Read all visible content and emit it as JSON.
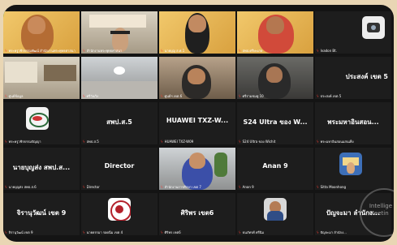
{
  "tiles": [
    {
      "caption": "พระครูวชิรธรรมพัฒน์ สำนักงานพระพุทธศาสนา",
      "name": ""
    },
    {
      "caption": "สำนักงานพระพุทธศาสนา",
      "name": ""
    },
    {
      "caption": "นายบุญ ส.ศ.1",
      "name": ""
    },
    {
      "caption": "สพป.ศรีษะเกษ",
      "name": ""
    },
    {
      "caption": "Ivadon Bt.",
      "name": ""
    },
    {
      "caption": "ศูนย์ข้อมูล",
      "name": ""
    },
    {
      "caption": "ศรีวังเวิง",
      "name": ""
    },
    {
      "caption": "ศูนย์ฯ เขต 6",
      "name": ""
    },
    {
      "caption": "ศรีรามชมพู 10",
      "name": ""
    },
    {
      "caption": "ประสงค์ เขต 5",
      "name": "ประสงค์ เขต 5"
    },
    {
      "caption": "พระครูวชิรธรรมปัญญา",
      "name": ""
    },
    {
      "caption": "สพป.ส.5",
      "name": "สพป.ส.5"
    },
    {
      "caption": "HUAWEI TXZ-W09",
      "name": "HUAWEI TXZ-W..."
    },
    {
      "caption": "S24 Ultra ของ Wichit",
      "name": "S24 Ultra ของ W..."
    },
    {
      "caption": "พระมหาอินสอนแสนเพ็ง",
      "name": "พระมหาอินสอน..."
    },
    {
      "caption": "นายบุญส่ง สพป.ส.6",
      "name": "นายบุญส่ง สพป.ส..."
    },
    {
      "caption": "Director",
      "name": "Director"
    },
    {
      "caption": "สำนักงานการศึกษา เขต 7",
      "name": ""
    },
    {
      "caption": "Anan 9",
      "name": "Anan 9"
    },
    {
      "caption": "Sitta Moonhong",
      "name": ""
    },
    {
      "caption": "จิรานุวัฒน์ เขต 9",
      "name": "จิรานุวัฒน์ เขต 9"
    },
    {
      "caption": "นายธรรมา รอดนิ่ม เขต 4",
      "name": ""
    },
    {
      "caption": "ศิริพร เขต6",
      "name": "ศิริพร เขต6"
    },
    {
      "caption": "ธนภัทรศ์ ศรีนิม",
      "name": ""
    },
    {
      "caption": "ปัญจะมา ลำนักง...",
      "name": "ปัญจะมา ลำนักง..."
    }
  ],
  "watermark": {
    "line1": "Intellige",
    "line2": "Meetin"
  },
  "colors": {
    "active_border": "#3ddc2b",
    "mic_muted": "#ff3b30"
  }
}
